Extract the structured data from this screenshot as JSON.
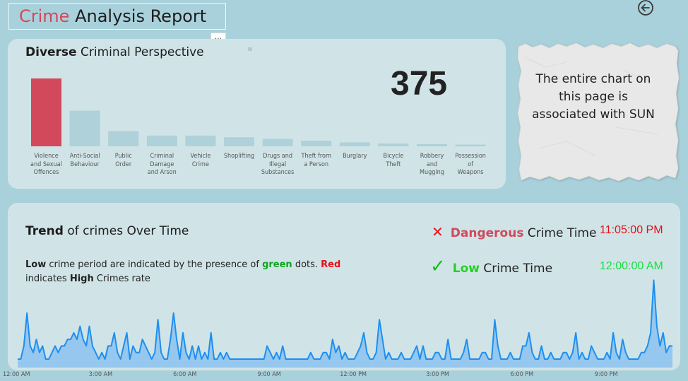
{
  "header": {
    "title_part1": "Crime",
    "title_part2": " Analysis Report",
    "more_label": "···"
  },
  "top_panel": {
    "title_bold": "Diverse",
    "title_rest": " Criminal Perspective",
    "total": "375"
  },
  "note": {
    "text": "The entire chart on this page is associated with SUN"
  },
  "trend_panel": {
    "title_bold": "Trend",
    "title_rest": " of crimes Over Time",
    "desc": {
      "t1": "Low",
      "t2": " crime period are indicated by the presence of ",
      "t3": "green",
      "t4": " dots. ",
      "t5": "Red",
      "t6": " indicates ",
      "t7": "High",
      "t8": " Crimes rate"
    },
    "danger_word": "Dangerous",
    "danger_rest": " Crime Time",
    "danger_time": "11:05:00 PM",
    "low_word": "Low",
    "low_rest": " Crime Time",
    "low_time": "12:00:00 AM"
  },
  "colors": {
    "highlight_bar": "#d1495b",
    "bar": "#aed1da",
    "line": "#1e8ff0",
    "area": "#8cc2ee"
  },
  "chart_data": [
    {
      "type": "bar",
      "categories": [
        "Violence and Sexual Offences",
        "Anti-Social Behaviour",
        "Public Order",
        "Criminal Damage and Arson",
        "Vehicle Crime",
        "Shoplifting",
        "Drugs and Illegal Substances",
        "Theft from a Person",
        "Burglary",
        "Bicycle Theft",
        "Robbery and Mugging",
        "Possession of Weapons"
      ],
      "category_lines": [
        [
          "Violence",
          "and Sexual",
          "Offences"
        ],
        [
          "Anti-Social",
          "Behaviour"
        ],
        [
          "Public",
          "Order"
        ],
        [
          "Criminal",
          "Damage",
          "and Arson"
        ],
        [
          "Vehicle",
          "Crime"
        ],
        [
          "Shoplifting"
        ],
        [
          "Drugs and",
          "Illegal",
          "Substances"
        ],
        [
          "Theft from",
          "a Person"
        ],
        [
          "Burglary"
        ],
        [
          "Bicycle",
          "Theft"
        ],
        [
          "Robbery",
          "and",
          "Mugging"
        ],
        [
          "Possession",
          "of",
          "Weapons"
        ]
      ],
      "values": [
        120,
        63,
        27,
        19,
        19,
        16,
        13,
        10,
        7,
        5,
        4,
        3
      ],
      "highlight_index": 0
    },
    {
      "type": "area",
      "x_ticks": [
        "12:00 AM",
        "3:00 AM",
        "6:00 AM",
        "9:00 AM",
        "12:00 PM",
        "3:00 PM",
        "6:00 PM",
        "9:00 PM"
      ],
      "x_range_hours": [
        0,
        24
      ],
      "values": [
        1,
        1,
        3,
        8,
        3,
        2,
        4,
        2,
        3,
        1,
        1,
        2,
        3,
        2,
        3,
        3,
        4,
        4,
        5,
        4,
        6,
        4,
        3,
        6,
        3,
        2,
        1,
        2,
        1,
        3,
        3,
        5,
        2,
        1,
        3,
        5,
        1,
        3,
        2,
        2,
        4,
        3,
        2,
        1,
        2,
        7,
        2,
        1,
        1,
        4,
        8,
        4,
        1,
        5,
        2,
        1,
        3,
        1,
        3,
        1,
        2,
        1,
        5,
        1,
        1,
        2,
        1,
        2,
        1,
        1,
        1,
        1,
        1,
        1,
        1,
        1,
        1,
        1,
        1,
        1,
        3,
        2,
        1,
        2,
        1,
        3,
        1,
        1,
        1,
        1,
        1,
        1,
        1,
        1,
        2,
        1,
        1,
        1,
        2,
        2,
        1,
        4,
        2,
        3,
        1,
        2,
        1,
        1,
        1,
        2,
        3,
        5,
        2,
        1,
        1,
        2,
        7,
        4,
        1,
        2,
        1,
        1,
        1,
        2,
        1,
        1,
        1,
        2,
        3,
        1,
        3,
        1,
        1,
        1,
        2,
        2,
        1,
        1,
        4,
        1,
        1,
        1,
        1,
        2,
        4,
        1,
        1,
        1,
        1,
        2,
        2,
        1,
        1,
        7,
        3,
        1,
        1,
        1,
        2,
        1,
        1,
        1,
        3,
        3,
        5,
        2,
        1,
        1,
        3,
        1,
        1,
        2,
        1,
        1,
        1,
        2,
        2,
        1,
        2,
        5,
        1,
        2,
        1,
        1,
        3,
        2,
        1,
        1,
        1,
        2,
        1,
        5,
        2,
        1,
        4,
        2,
        1,
        1,
        1,
        1,
        2,
        2,
        3,
        5,
        13,
        6,
        3,
        5,
        2,
        3,
        3
      ]
    }
  ]
}
